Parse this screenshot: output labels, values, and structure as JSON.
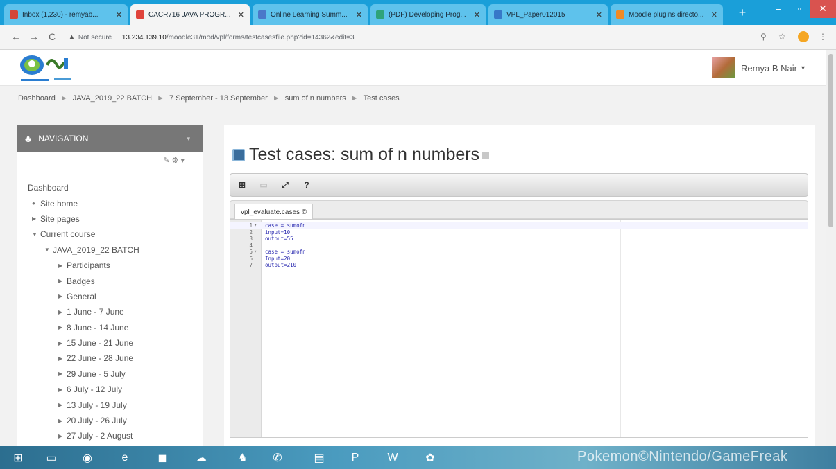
{
  "browser": {
    "tabs": [
      {
        "title": "Inbox (1,230) - remyab...",
        "color": "#d44638",
        "active": false
      },
      {
        "title": "CACR716 JAVA PROGR...",
        "color": "#e0433b",
        "active": true
      },
      {
        "title": "Online Learning Summ...",
        "color": "#4a77c9",
        "active": false
      },
      {
        "title": "(PDF) Developing Prog...",
        "color": "#2fa37a",
        "active": false
      },
      {
        "title": "VPL_Paper012015",
        "color": "#3779c8",
        "active": false
      },
      {
        "title": "Moodle plugins directo...",
        "color": "#f08a24",
        "active": false
      }
    ],
    "new_tab": "+",
    "window_controls": {
      "minimize": "–",
      "maximize": "▫",
      "close": "✕"
    },
    "back": "←",
    "forward": "→",
    "reload": "C",
    "security": "Not secure",
    "url_host": "13.234.139.10",
    "url_path": "/moodle31/mod/vpl/forms/testcasesfile.php?id=14362&edit=3",
    "zoom_icon": "magnify-icon",
    "star_icon": "star-icon"
  },
  "moodle": {
    "user": {
      "name": "Remya B Nair",
      "caret": "▾"
    },
    "breadcrumb": [
      "Dashboard",
      "JAVA_2019_22 BATCH",
      "7 September - 13 September",
      "sum of n numbers",
      "Test cases"
    ],
    "nav": {
      "title": "NAVIGATION",
      "tools": "✎ ⚙ ▾",
      "items": [
        {
          "label": "Dashboard",
          "marker": ""
        },
        {
          "label": "Site home",
          "marker": "●"
        },
        {
          "label": "Site pages",
          "marker": "▶"
        },
        {
          "label": "Current course",
          "marker": "▼"
        },
        {
          "label": "JAVA_2019_22 BATCH",
          "marker": "▼"
        },
        {
          "label": "Participants",
          "marker": "▶"
        },
        {
          "label": "Badges",
          "marker": "▶"
        },
        {
          "label": "General",
          "marker": "▶"
        },
        {
          "label": "1 June - 7 June",
          "marker": "▶"
        },
        {
          "label": "8 June - 14 June",
          "marker": "▶"
        },
        {
          "label": "15 June - 21 June",
          "marker": "▶"
        },
        {
          "label": "22 June - 28 June",
          "marker": "▶"
        },
        {
          "label": "29 June - 5 July",
          "marker": "▶"
        },
        {
          "label": "6 July - 12 July",
          "marker": "▶"
        },
        {
          "label": "13 July - 19 July",
          "marker": "▶"
        },
        {
          "label": "20 July - 26 July",
          "marker": "▶"
        },
        {
          "label": "27 July - 2 August",
          "marker": "▶"
        }
      ]
    },
    "page_title": "Test cases: sum of n numbers",
    "toolbar": [
      {
        "icon": "⊞",
        "name": "new-file-icon",
        "disabled": false
      },
      {
        "icon": "▭",
        "name": "save-icon",
        "disabled": true
      },
      {
        "icon": "⤢",
        "name": "fullscreen-icon",
        "disabled": false
      },
      {
        "icon": "?",
        "name": "help-icon",
        "disabled": false
      }
    ],
    "file_tab": "vpl_evaluate.cases ©",
    "code_lines": [
      {
        "n": "1",
        "fold": "▾",
        "text": "case = sumofn"
      },
      {
        "n": "2",
        "fold": "",
        "text": "input=10"
      },
      {
        "n": "3",
        "fold": "",
        "text": "output=55"
      },
      {
        "n": "4",
        "fold": "",
        "text": ""
      },
      {
        "n": "5",
        "fold": "▾",
        "text": "case = sumofn"
      },
      {
        "n": "6",
        "fold": "",
        "text": "Input=20"
      },
      {
        "n": "7",
        "fold": "",
        "text": "output=210"
      }
    ]
  },
  "taskbar": {
    "watermark": "Pokemon©Nintendo/GameFreak"
  }
}
